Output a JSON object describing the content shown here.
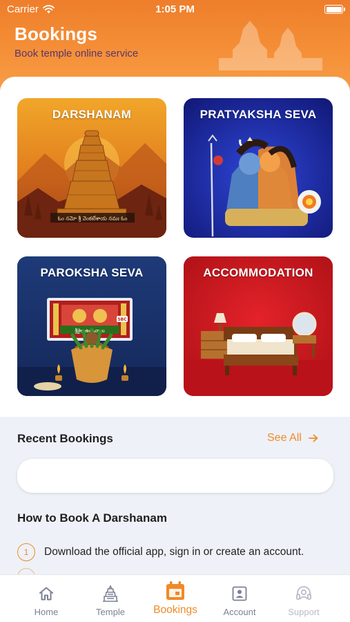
{
  "status_bar": {
    "carrier": "Carrier",
    "time": "1:05 PM"
  },
  "header": {
    "title": "Bookings",
    "subtitle": "Book temple online service",
    "background_color": "#f28a33"
  },
  "tiles": [
    {
      "label": "DARSHANAM",
      "banner_text": "ఓం నమో శ్రీ వెంకటేశాయ నమః ఓం"
    },
    {
      "label": "PRATYAKSHA SEVA"
    },
    {
      "label": "PAROKSHA SEVA",
      "screen_caption": "శ్రీశైల ఉత్సవాలు",
      "channel_badge": "SBC"
    },
    {
      "label": "ACCOMMODATION"
    }
  ],
  "recent_bookings": {
    "title": "Recent Bookings",
    "see_all": "See All",
    "accent_color": "#ef8a2a"
  },
  "how_to": {
    "title": "How to Book A Darshanam",
    "steps": [
      {
        "number": "1",
        "text": "Download the official app, sign in or create an account."
      }
    ]
  },
  "tab_bar": {
    "items": [
      {
        "label": "Home",
        "icon": "home-icon",
        "state": "normal"
      },
      {
        "label": "Temple",
        "icon": "temple-icon",
        "state": "normal"
      },
      {
        "label": "Bookings",
        "icon": "calendar-icon",
        "state": "active"
      },
      {
        "label": "Account",
        "icon": "account-icon",
        "state": "normal"
      },
      {
        "label": "Support",
        "icon": "headset-icon",
        "state": "disabled"
      }
    ]
  }
}
